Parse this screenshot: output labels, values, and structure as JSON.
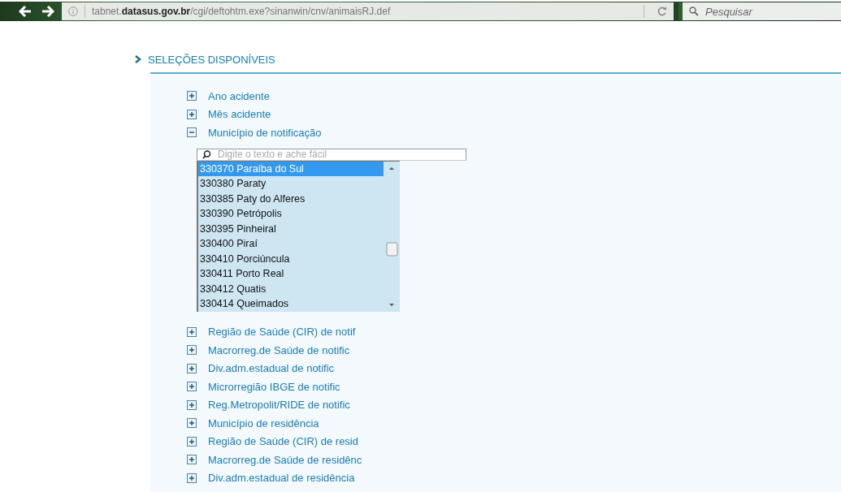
{
  "browser": {
    "url": "tabnet.**datasus.gov.br**/cgi/deftohtm.exe?sinanwin/cnv/animaisRJ.def",
    "search": {
      "placeholder": "Pesquisar"
    }
  },
  "section": {
    "title": "SELEÇÕES DISPONÍVEIS",
    "items": [
      {
        "label": "Ano acidente",
        "expanded": false
      },
      {
        "label": "Mês acidente",
        "expanded": false
      },
      {
        "label": "Município de notificação",
        "expanded": true,
        "filter": {
          "placeholder": "Digite o texto e ache fácil"
        },
        "options": [
          {
            "label": "330370 Paraíba do Sul",
            "selected": true
          },
          {
            "label": "330380 Paraty",
            "selected": false
          },
          {
            "label": "330385 Paty do Alferes",
            "selected": false
          },
          {
            "label": "330390 Petrópolis",
            "selected": false
          },
          {
            "label": "330395 Pinheiral",
            "selected": false
          },
          {
            "label": "330400 Piraí",
            "selected": false
          },
          {
            "label": "330410 Porciúncula",
            "selected": false
          },
          {
            "label": "330411 Porto Real",
            "selected": false
          },
          {
            "label": "330412 Quatis",
            "selected": false
          },
          {
            "label": "330414 Queimados",
            "selected": false
          }
        ]
      },
      {
        "label": "Região de Saúde (CIR) de notif",
        "expanded": false
      },
      {
        "label": "Macrorreg.de Saúde de notific",
        "expanded": false
      },
      {
        "label": "Div.adm.estadual de notific",
        "expanded": false
      },
      {
        "label": "Microrregião IBGE de notific",
        "expanded": false
      },
      {
        "label": "Reg.Metropolit/RIDE de notific",
        "expanded": false
      },
      {
        "label": "Município de residência",
        "expanded": false
      },
      {
        "label": "Região de Saúde (CIR) de resid",
        "expanded": false
      },
      {
        "label": "Macrorreg.de Saúde de residênc",
        "expanded": false
      },
      {
        "label": "Div.adm.estadual de residência",
        "expanded": false
      }
    ]
  }
}
